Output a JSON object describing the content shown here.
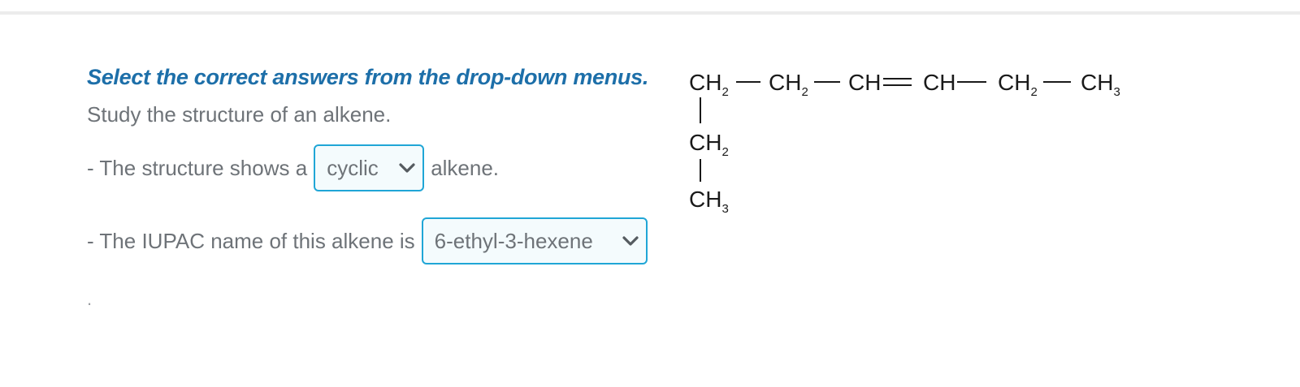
{
  "question": {
    "instruction": "Select the correct answers from the drop-down menus.",
    "prompt": "Study the structure of an alkene.",
    "statement1": {
      "before": "- The structure shows a",
      "dropdown_value": "cyclic",
      "after": "alkene."
    },
    "statement2": {
      "before": "- The IUPAC name of this alkene is",
      "dropdown_value": "6-ethyl-3-hexene"
    },
    "trailing": "."
  },
  "structure": {
    "main_chain": [
      "CH2",
      "CH2",
      "CH",
      "CH",
      "CH2",
      "CH3"
    ],
    "bonds": [
      "single",
      "single",
      "double",
      "single",
      "single"
    ],
    "branch": [
      "CH2",
      "CH3"
    ]
  },
  "colors": {
    "instruction": "#1d6fa9",
    "dropdown_border": "#20a6d6",
    "body_text": "#6e7378"
  },
  "icons": {
    "dropdown": "chevron-down-icon"
  }
}
